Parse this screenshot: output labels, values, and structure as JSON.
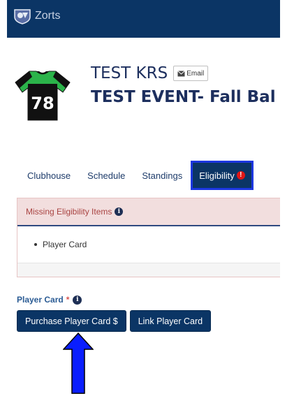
{
  "header": {
    "brand": "Zorts"
  },
  "profile": {
    "name": "TEST KRS",
    "email_button": "Email",
    "event": "TEST EVENT- Fall Bal",
    "jersey_number": "78"
  },
  "tabs": [
    {
      "label": "Clubhouse"
    },
    {
      "label": "Schedule"
    },
    {
      "label": "Standings"
    },
    {
      "label": "Eligibility",
      "badge": "!"
    }
  ],
  "eligibility_panel": {
    "heading": "Missing Eligibility Items",
    "items": [
      "Player Card"
    ]
  },
  "player_card": {
    "label": "Player Card",
    "required_mark": "*",
    "buttons": {
      "purchase": "Purchase Player Card $",
      "link": "Link Player Card"
    }
  },
  "colors": {
    "navy": "#0b3565",
    "highlight_blue": "#1c37e0",
    "jersey_green": "#2bb34a",
    "alert_red": "#a94442"
  },
  "icons": [
    "zorts-logo-icon",
    "jersey-icon",
    "envelope-icon",
    "exclamation-icon",
    "info-icon",
    "arrow-up-icon"
  ]
}
